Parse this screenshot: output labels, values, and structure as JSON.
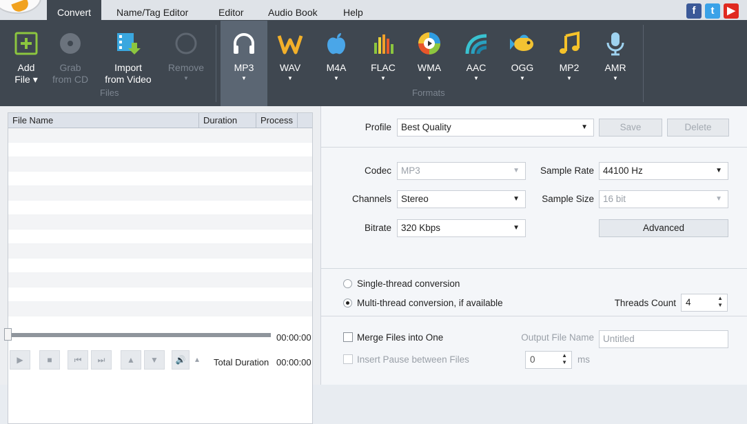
{
  "menu": {
    "items": [
      "Convert",
      "Name/Tag Editor",
      "Editor",
      "Audio Book",
      "Help"
    ]
  },
  "social": [
    "facebook-icon",
    "twitter-icon",
    "youtube-icon"
  ],
  "toolbar": {
    "files": [
      {
        "line1": "Add",
        "line2": "File ▾",
        "icon": "add-file-icon",
        "enabled": true
      },
      {
        "line1": "Grab",
        "line2": "from CD",
        "icon": "cd-icon",
        "enabled": false
      },
      {
        "line1": "Import",
        "line2": "from Video",
        "icon": "film-icon",
        "enabled": true
      },
      {
        "line1": "Remove",
        "line2": "",
        "icon": "remove-icon",
        "enabled": false
      }
    ],
    "files_group_label": "Files",
    "formats": [
      {
        "label": "MP3",
        "icon": "headphones-icon",
        "color": "#ffffff",
        "selected": true
      },
      {
        "label": "WAV",
        "icon": "wav-icon",
        "color": "#f2b02a"
      },
      {
        "label": "M4A",
        "icon": "apple-icon",
        "color": "#4aa6e8"
      },
      {
        "label": "FLAC",
        "icon": "equalizer-icon",
        "color": "#e8d33a"
      },
      {
        "label": "WMA",
        "icon": "media-player-icon",
        "color": "#e8562a"
      },
      {
        "label": "AAC",
        "icon": "aac-wave-icon",
        "color": "#39c2d0"
      },
      {
        "label": "OGG",
        "icon": "fish-icon",
        "color": "#f2c232"
      },
      {
        "label": "MP2",
        "icon": "music-note-icon",
        "color": "#f5c22a"
      },
      {
        "label": "AMR",
        "icon": "microphone-icon",
        "color": "#9fd3f0"
      }
    ],
    "formats_group_label": "Formats"
  },
  "filelist": {
    "columns": [
      "File Name",
      "Duration",
      "Process"
    ]
  },
  "player": {
    "position": "00:00:00",
    "total_label": "Total Duration",
    "total": "00:00:00"
  },
  "profile": {
    "label": "Profile",
    "value": "Best Quality",
    "save": "Save",
    "delete": "Delete"
  },
  "settings": {
    "codec": {
      "label": "Codec",
      "value": "MP3"
    },
    "channels": {
      "label": "Channels",
      "value": "Stereo"
    },
    "bitrate": {
      "label": "Bitrate",
      "value": "320 Kbps"
    },
    "sample_rate": {
      "label": "Sample Rate",
      "value": "44100 Hz"
    },
    "sample_size": {
      "label": "Sample Size",
      "value": "16 bit"
    },
    "advanced": "Advanced"
  },
  "threads": {
    "single": "Single-thread conversion",
    "multi": "Multi-thread conversion, if available",
    "count_label": "Threads Count",
    "count": "4"
  },
  "output": {
    "merge": "Merge Files into One",
    "insert_pause": "Insert Pause between Files",
    "file_name_label": "Output File Name",
    "file_name_placeholder": "Untitled",
    "pause_value": "0",
    "pause_unit": "ms"
  }
}
